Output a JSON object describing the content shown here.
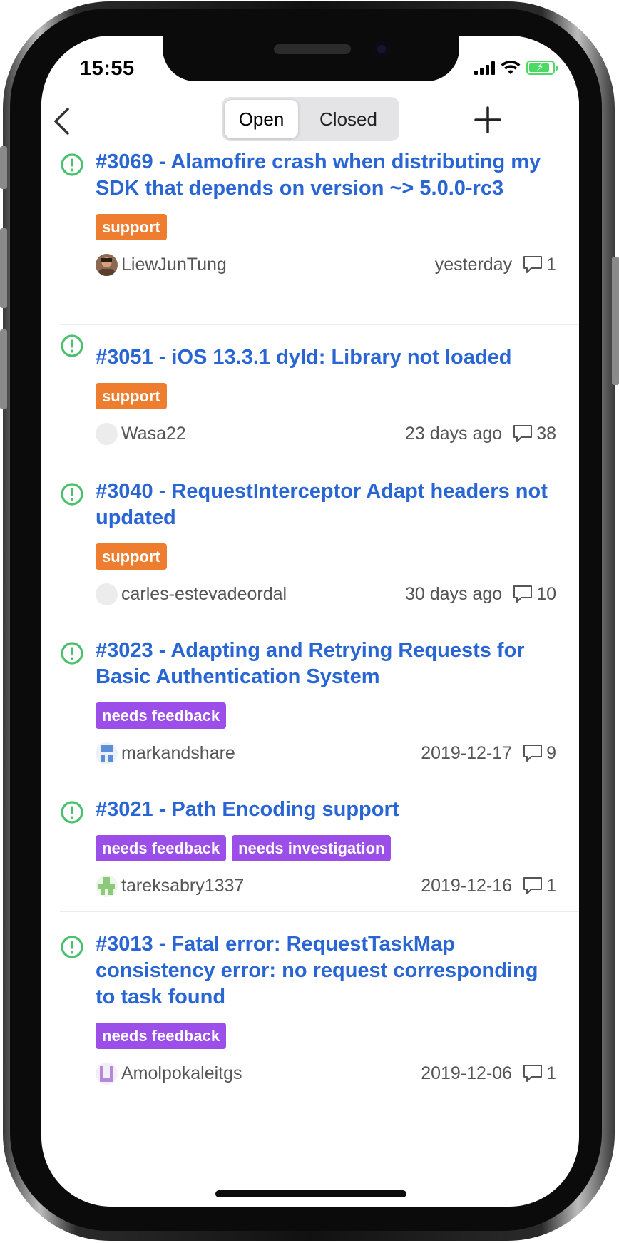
{
  "status_bar": {
    "time": "15:55"
  },
  "nav": {
    "segments": {
      "open": "Open",
      "closed": "Closed"
    },
    "selected_segment": "Open",
    "back_icon": "chevron-left-icon",
    "add_icon": "plus-icon"
  },
  "colors": {
    "link": "#2966d3",
    "open_issue_icon": "#4cc06e",
    "label_support": "#ee7d2f",
    "label_needs_feedback": "#9b4fe8",
    "label_needs_investigation": "#9b4fe8"
  },
  "issues": [
    {
      "title": "#3069 - Alamofire crash when distributing my SDK that depends on version  ~> 5.0.0-rc3",
      "labels": [
        {
          "text": "support",
          "color": "#ee7d2f"
        }
      ],
      "author": "LiewJunTung",
      "date": "yesterday",
      "comments": "1"
    },
    {
      "title": "#3051 - iOS 13.3.1 dyld: Library not loaded",
      "labels": [
        {
          "text": "support",
          "color": "#ee7d2f"
        }
      ],
      "author": "Wasa22",
      "date": "23 days ago",
      "comments": "38"
    },
    {
      "title": "#3040 - RequestInterceptor Adapt headers not updated",
      "labels": [
        {
          "text": "support",
          "color": "#ee7d2f"
        }
      ],
      "author": "carles-estevadeordal",
      "date": "30 days ago",
      "comments": "10"
    },
    {
      "title": "#3023 - Adapting and Retrying Requests for Basic Authentication System",
      "labels": [
        {
          "text": "needs feedback",
          "color": "#9b4fe8"
        }
      ],
      "author": "markandshare",
      "date": "2019-12-17",
      "comments": "9"
    },
    {
      "title": "#3021 - Path Encoding support",
      "labels": [
        {
          "text": "needs feedback",
          "color": "#9b4fe8"
        },
        {
          "text": "needs investigation",
          "color": "#9b4fe8"
        }
      ],
      "author": "tareksabry1337",
      "date": "2019-12-16",
      "comments": "1"
    },
    {
      "title": "#3013 - Fatal error: RequestTaskMap consistency error: no request corresponding to task found",
      "labels": [
        {
          "text": "needs feedback",
          "color": "#9b4fe8"
        }
      ],
      "author": "Amolpokaleitgs",
      "date": "2019-12-06",
      "comments": "1"
    }
  ]
}
